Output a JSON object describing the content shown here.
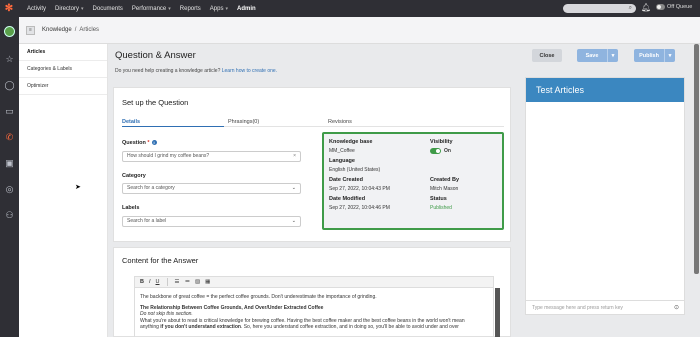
{
  "nav": {
    "items": [
      {
        "label": "Activity",
        "caret": ""
      },
      {
        "label": "Directory",
        "caret": "▾"
      },
      {
        "label": "Documents",
        "caret": ""
      },
      {
        "label": "Performance",
        "caret": "▾"
      },
      {
        "label": "Reports",
        "caret": ""
      },
      {
        "label": "Apps",
        "caret": "▾"
      },
      {
        "label": "Admin",
        "caret": ""
      }
    ],
    "queue_label": "Off Queue"
  },
  "breadcrumb": {
    "root": "Knowledge",
    "sep": "/",
    "current": "Articles"
  },
  "left_panel": {
    "items": [
      "Articles",
      "Categories & Labels",
      "Optimizer"
    ]
  },
  "page": {
    "title": "Question & Answer",
    "help_text": "Do you need help creating a knowledge article?",
    "help_link": "Learn how to create one."
  },
  "buttons": {
    "close": "Close",
    "save": "Save",
    "publish": "Publish",
    "caret": "▾"
  },
  "setup": {
    "title": "Set up the Question",
    "tabs": [
      "Details",
      "Phrasings(0)",
      "Revisions"
    ],
    "question_label": "Question",
    "question_value": "How should I grind my coffee beans?",
    "category_label": "Category",
    "category_placeholder": "Search for a category",
    "labels_label": "Labels",
    "labels_placeholder": "Search for a label",
    "meta": {
      "kb_label": "Knowledge base",
      "kb_value": "MM_Coffee",
      "visibility_label": "Visibility",
      "visibility_value": "On",
      "language_label": "Language",
      "language_value": "English (United States)",
      "created_label": "Date Created",
      "created_value": "Sep 27, 2022, 10:04:43 PM",
      "created_by_label": "Created By",
      "created_by_value": "Mitch Mason",
      "modified_label": "Date Modified",
      "modified_value": "Sep 27, 2022, 10:04:46 PM",
      "status_label": "Status",
      "status_value": "Published"
    }
  },
  "content": {
    "title": "Content for the Answer",
    "para1": "The backbone of great coffee = the perfect coffee grounds. Don't underestimate the importance of grinding.",
    "heading": "The Relationship Between Coffee Grounds, And Over/Under Extracted Coffee",
    "note": "Do not skip this section.",
    "para2": "What you're about to read is critical knowledge for brewing coffee. Having the best coffee maker and the best coffee beans in the world won't mean",
    "para3a": "anything",
    "para3b": "if you don't understand extraction",
    "para3c": ". So, here you understand coffee extraction, and in doing so, you'll be able to avoid under and over"
  },
  "test_panel": {
    "title": "Test Articles",
    "input_placeholder": "Type message here and press return key"
  }
}
